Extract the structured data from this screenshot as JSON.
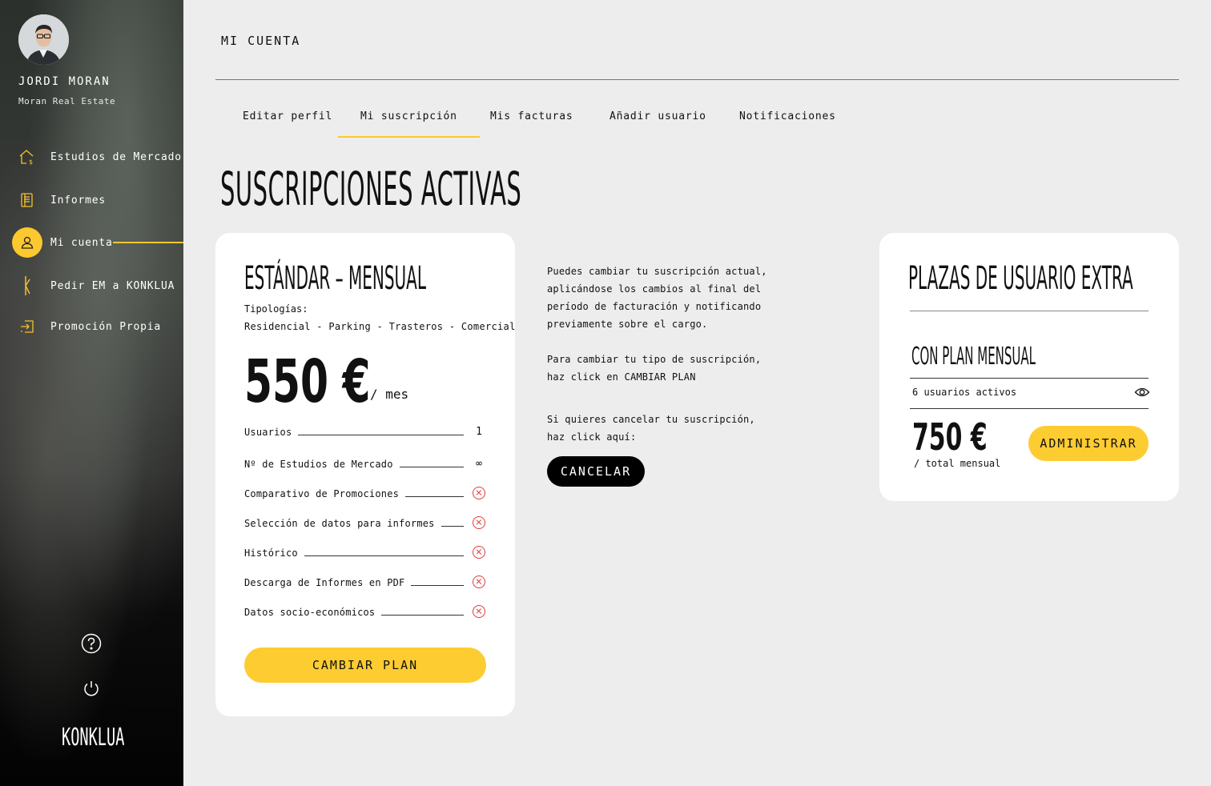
{
  "user": {
    "name": "JORDI MORAN",
    "company": "Moran Real Estate"
  },
  "sidebar": {
    "items": [
      {
        "label": "Estudios de Mercado",
        "icon": "house-euro-icon"
      },
      {
        "label": "Informes",
        "icon": "report-icon"
      },
      {
        "label": "Mi cuenta",
        "icon": "user-icon",
        "active": true
      },
      {
        "label": "Pedir EM a KONKLUA",
        "icon": "konklua-k-icon"
      },
      {
        "label": "Promoción Propia",
        "icon": "login-arrow-icon"
      }
    ],
    "brand": "KONKLUA"
  },
  "header": {
    "title": "MI CUENTA"
  },
  "tabs": [
    {
      "label": "Editar perfil"
    },
    {
      "label": "Mi suscripción",
      "active": true
    },
    {
      "label": "Mis facturas"
    },
    {
      "label": "Añadir usuario"
    },
    {
      "label": "Notificaciones"
    }
  ],
  "section": {
    "heading": "SUSCRIPCIONES ACTIVAS"
  },
  "plan": {
    "title": "ESTÁNDAR – MENSUAL",
    "typologies_label": "Tipologías:",
    "typologies": "Residencial  -  Parking  -  Trasteros  -  Comercial",
    "price": "550 €",
    "price_unit": "/ mes",
    "features": [
      {
        "label": "Usuarios",
        "value": "1"
      },
      {
        "label": "Nº de Estudios de Mercado",
        "value": "∞"
      },
      {
        "label": "Comparativo de Promociones",
        "value": "no"
      },
      {
        "label": "Selección de datos para informes",
        "value": "no"
      },
      {
        "label": "Histórico",
        "value": "no"
      },
      {
        "label": "Descarga de Informes en PDF",
        "value": "no"
      },
      {
        "label": "Datos socio-económicos",
        "value": "no"
      }
    ],
    "button": "CAMBIAR PLAN"
  },
  "info": {
    "p1": "Puedes cambiar tu suscripción actual,\naplicándose los cambios al final del\nperíodo de facturación y notificando\npreviamente sobre el cargo.",
    "p2": "Para cambiar tu tipo de suscripción,\nhaz click en CAMBIAR PLAN",
    "p3": "Si quieres cancelar tu suscripción,\nhaz click aquí:",
    "cancel_button": "CANCELAR"
  },
  "extra": {
    "title": "PLAZAS DE USUARIO EXTRA",
    "subtitle": "CON PLAN MENSUAL",
    "users_active": "6 usuarios activos",
    "price": "750 €",
    "price_unit": "/ total mensual",
    "button": "ADMINISTRAR"
  },
  "colors": {
    "accent": "#fdcc31",
    "background": "#ededed",
    "error": "#e23a3a"
  }
}
